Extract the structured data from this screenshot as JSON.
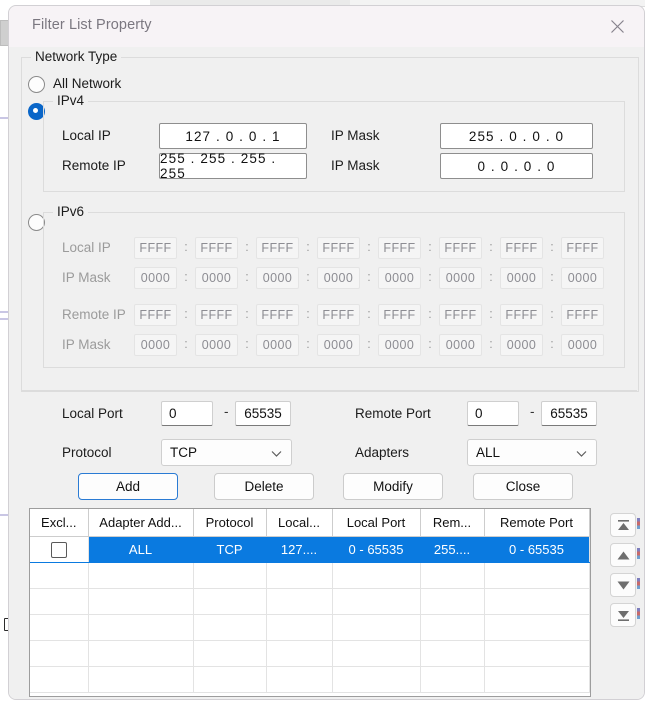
{
  "window": {
    "title": "Filter List Property",
    "close_icon": "close-icon"
  },
  "network_type": {
    "group_label": "Network Type",
    "options": [
      {
        "id": "all",
        "label": "All Network",
        "selected": false
      },
      {
        "id": "ipv4",
        "label": "IPv4",
        "selected": true
      },
      {
        "id": "ipv6",
        "label": "IPv6",
        "selected": false
      }
    ]
  },
  "ipv4": {
    "group_label": "IPv4",
    "local_ip_label": "Local IP",
    "local_ip_value": "127 . 0  . 0  . 1",
    "remote_ip_label": "Remote IP",
    "remote_ip_value": "255 . 255 . 255 . 255",
    "mask1_label": "IP Mask",
    "mask1_value": "255 . 0  . 0  . 0",
    "mask2_label": "IP Mask",
    "mask2_value": "0  . 0  . 0  . 0"
  },
  "ipv6": {
    "group_label": "IPv6",
    "enabled": false,
    "rows": [
      {
        "label": "Local IP",
        "values": [
          "FFFF",
          "FFFF",
          "FFFF",
          "FFFF",
          "FFFF",
          "FFFF",
          "FFFF",
          "FFFF"
        ]
      },
      {
        "label": "IP Mask",
        "values": [
          "0000",
          "0000",
          "0000",
          "0000",
          "0000",
          "0000",
          "0000",
          "0000"
        ]
      },
      {
        "label": "Remote IP",
        "values": [
          "FFFF",
          "FFFF",
          "FFFF",
          "FFFF",
          "FFFF",
          "FFFF",
          "FFFF",
          "FFFF"
        ]
      },
      {
        "label": "IP Mask",
        "values": [
          "0000",
          "0000",
          "0000",
          "0000",
          "0000",
          "0000",
          "0000",
          "0000"
        ]
      }
    ],
    "separator": ":"
  },
  "ports": {
    "local_port_label": "Local Port",
    "local_port_from": "0",
    "local_port_to": "65535",
    "remote_port_label": "Remote Port",
    "remote_port_from": "0",
    "remote_port_to": "65535",
    "range_dash": "-",
    "protocol_label": "Protocol",
    "protocol_value": "TCP",
    "adapters_label": "Adapters",
    "adapters_value": "ALL"
  },
  "buttons": {
    "add": "Add",
    "delete": "Delete",
    "modify": "Modify",
    "close": "Close"
  },
  "table": {
    "columns": [
      "Excl...",
      "Adapter Add...",
      "Protocol",
      "Local...",
      "Local Port",
      "Rem...",
      "Remote Port"
    ],
    "rows": [
      {
        "selected": true,
        "checked": false,
        "cells": [
          "",
          "ALL",
          "TCP",
          "127....",
          "0 - 65535",
          "255....",
          "0 - 65535"
        ]
      }
    ],
    "empty_row_count": 5
  },
  "side_nav": {
    "buttons": [
      {
        "name": "move-to-top-button",
        "icon": "triangle-up-bar-icon"
      },
      {
        "name": "move-up-button",
        "icon": "triangle-up-icon"
      },
      {
        "name": "move-down-button",
        "icon": "triangle-down-icon"
      },
      {
        "name": "move-to-bottom-button",
        "icon": "triangle-down-bar-icon"
      }
    ]
  },
  "colors": {
    "selection_blue": "#0a7ae0",
    "radio_accent": "#0a66c8",
    "focus_border": "#2a7bd4",
    "dialog_bg": "#f0f0f0",
    "titlebar_bg": "#f7f3f6"
  }
}
